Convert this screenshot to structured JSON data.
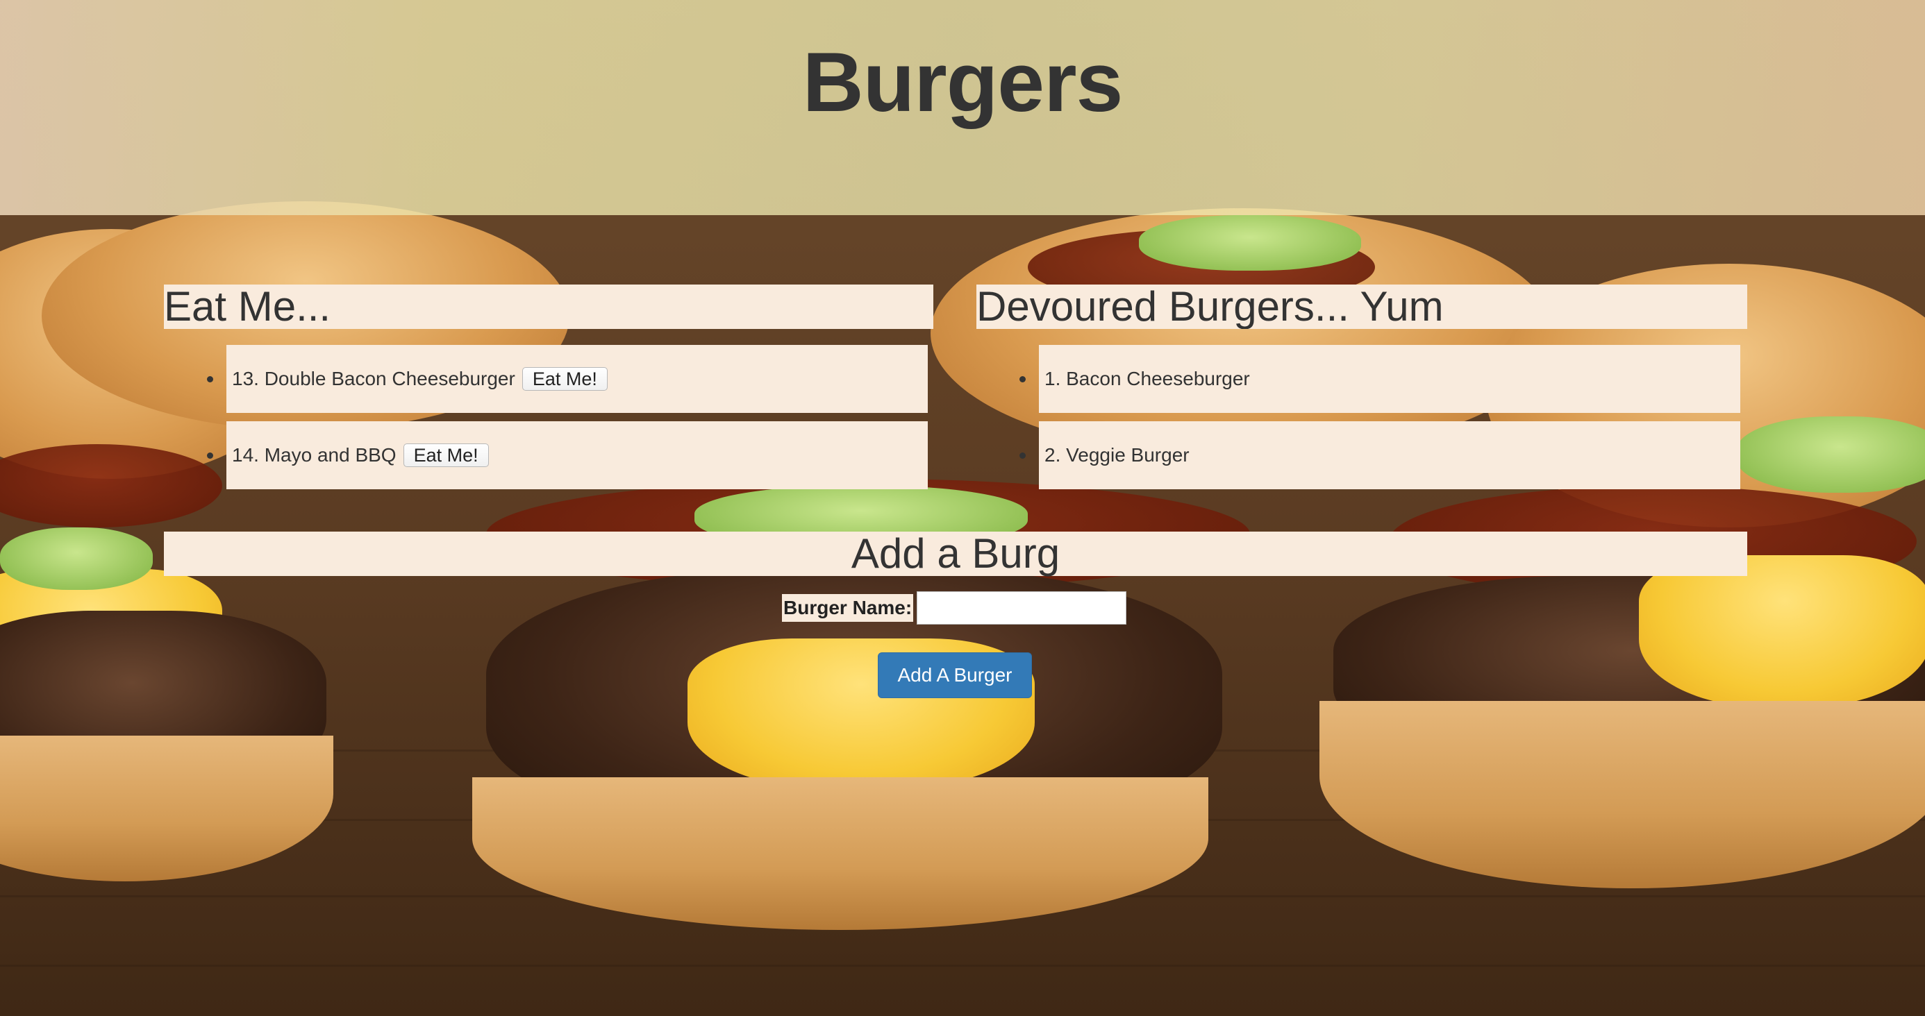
{
  "header": {
    "title": "Burgers"
  },
  "to_eat": {
    "heading": "Eat Me...",
    "items": [
      {
        "label": "13. Double Bacon Cheeseburger",
        "button": "Eat Me!"
      },
      {
        "label": "14. Mayo and BBQ",
        "button": "Eat Me!"
      }
    ]
  },
  "devoured": {
    "heading": "Devoured Burgers... Yum",
    "items": [
      {
        "label": "1. Bacon Cheeseburger"
      },
      {
        "label": "2. Veggie Burger"
      }
    ]
  },
  "add_form": {
    "heading": "Add a Burg",
    "field_label": "Burger Name:",
    "field_value": "",
    "submit_label": "Add A Burger"
  },
  "colors": {
    "panel_bg": "#f9ebdd",
    "primary_button": "#337ab7",
    "text": "#333333"
  }
}
